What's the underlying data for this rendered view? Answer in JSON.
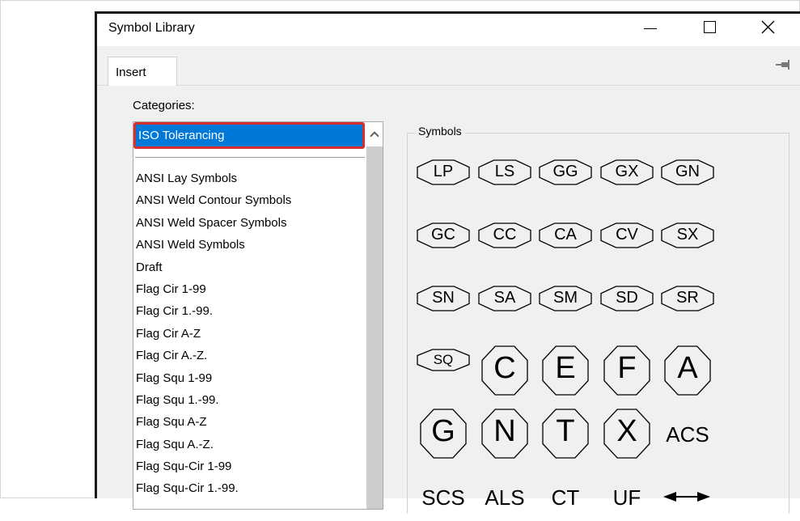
{
  "window": {
    "title": "Symbol Library"
  },
  "tabs": [
    {
      "label": "Insert"
    }
  ],
  "categories": {
    "label": "Categories:",
    "selected": "ISO Tolerancing",
    "items": [
      "ANSI Lay Symbols",
      "ANSI Weld Contour Symbols",
      "ANSI Weld Spacer Symbols",
      "ANSI Weld Symbols",
      "Draft",
      "Flag Cir 1-99",
      "Flag Cir 1.-99.",
      "Flag Cir A-Z",
      "Flag Cir A.-Z.",
      "Flag Squ 1-99",
      "Flag Squ 1.-99.",
      "Flag Squ A-Z",
      "Flag Squ A.-Z.",
      "Flag Squ-Cir 1-99",
      "Flag Squ-Cir 1.-99."
    ]
  },
  "symbols": {
    "group_label": "Symbols",
    "rows": [
      [
        {
          "label": "LP",
          "shape": "ellipse"
        },
        {
          "label": "LS",
          "shape": "ellipse"
        },
        {
          "label": "GG",
          "shape": "ellipse"
        },
        {
          "label": "GX",
          "shape": "ellipse"
        },
        {
          "label": "GN",
          "shape": "ellipse"
        }
      ],
      [
        {
          "label": "GC",
          "shape": "ellipse"
        },
        {
          "label": "CC",
          "shape": "ellipse"
        },
        {
          "label": "CA",
          "shape": "ellipse"
        },
        {
          "label": "CV",
          "shape": "ellipse"
        },
        {
          "label": "SX",
          "shape": "ellipse"
        }
      ],
      [
        {
          "label": "SN",
          "shape": "ellipse"
        },
        {
          "label": "SA",
          "shape": "ellipse"
        },
        {
          "label": "SM",
          "shape": "ellipse"
        },
        {
          "label": "SD",
          "shape": "ellipse"
        },
        {
          "label": "SR",
          "shape": "ellipse"
        }
      ],
      [
        {
          "label": "SQ",
          "shape": "ellipse-small"
        },
        {
          "label": "C",
          "shape": "circle"
        },
        {
          "label": "E",
          "shape": "circle"
        },
        {
          "label": "F",
          "shape": "circle"
        },
        {
          "label": "A",
          "shape": "circle"
        }
      ],
      [
        {
          "label": "G",
          "shape": "circle"
        },
        {
          "label": "N",
          "shape": "circle"
        },
        {
          "label": "T",
          "shape": "circle"
        },
        {
          "label": "X",
          "shape": "circle"
        },
        {
          "label": "ACS",
          "shape": "text"
        }
      ],
      [
        {
          "label": "SCS",
          "shape": "text"
        },
        {
          "label": "ALS",
          "shape": "text"
        },
        {
          "label": "CT",
          "shape": "text"
        },
        {
          "label": "UF",
          "shape": "text"
        },
        {
          "label": "",
          "shape": "double-arrow",
          "icon": "double-arrow-icon"
        }
      ]
    ]
  },
  "colors": {
    "selection": "#0078d7",
    "highlight_border": "#d32f2f",
    "dialog_bg": "#f0f0f0"
  }
}
